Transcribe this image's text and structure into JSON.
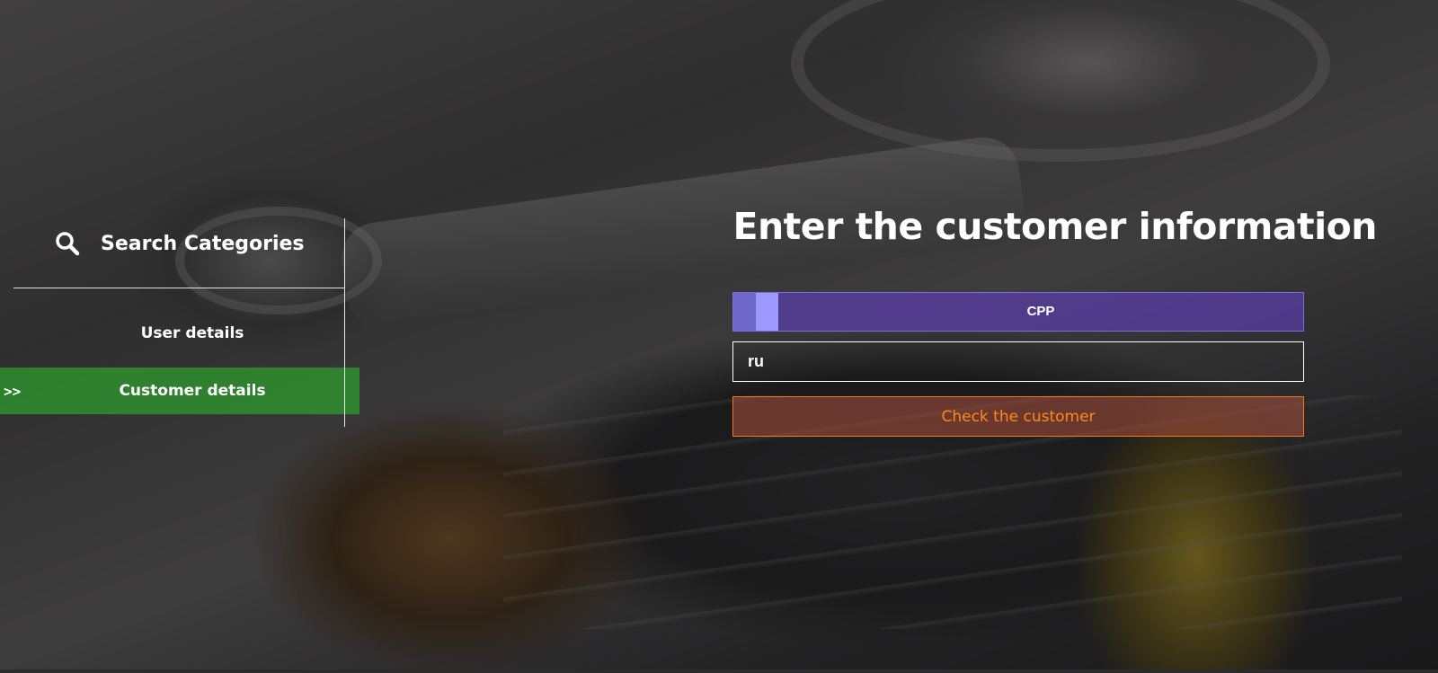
{
  "sidebar": {
    "search_title": "Search Categories",
    "items": [
      {
        "label": "User details",
        "active": false
      },
      {
        "label": "Customer details",
        "active": true,
        "marker": ">>"
      }
    ],
    "active_color": "#2ea02e"
  },
  "main": {
    "title": "Enter the customer information",
    "toggle": {
      "label": "CPP",
      "color": "#5a3caa"
    },
    "input": {
      "value": "ru"
    },
    "submit_label": "Check the customer",
    "submit_color": "#f07a1a"
  }
}
